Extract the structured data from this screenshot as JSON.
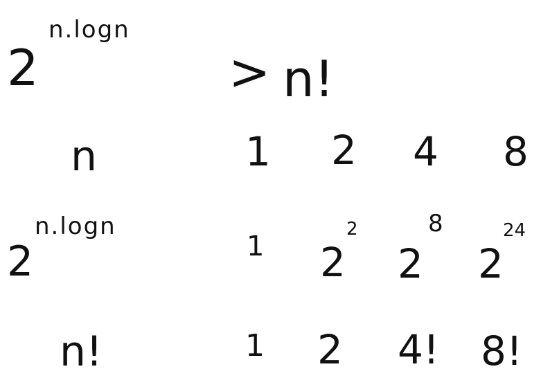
{
  "inequality": {
    "base": "2",
    "exponent": "n.logn",
    "relation": ">",
    "rhs": "n!"
  },
  "table": {
    "rows": [
      {
        "label": "n",
        "cells": [
          {
            "base": "1"
          },
          {
            "base": "2"
          },
          {
            "base": "4"
          },
          {
            "base": "8"
          }
        ]
      },
      {
        "label_base": "2",
        "label_exp": "n.logn",
        "cells": [
          {
            "base": "1"
          },
          {
            "base": "2",
            "exp": "2"
          },
          {
            "base": "2",
            "exp": "8"
          },
          {
            "base": "2",
            "exp": "24"
          }
        ]
      },
      {
        "label": "n!",
        "cells": [
          {
            "base": "1"
          },
          {
            "base": "2"
          },
          {
            "base": "4!"
          },
          {
            "base": "8!"
          }
        ]
      }
    ]
  }
}
